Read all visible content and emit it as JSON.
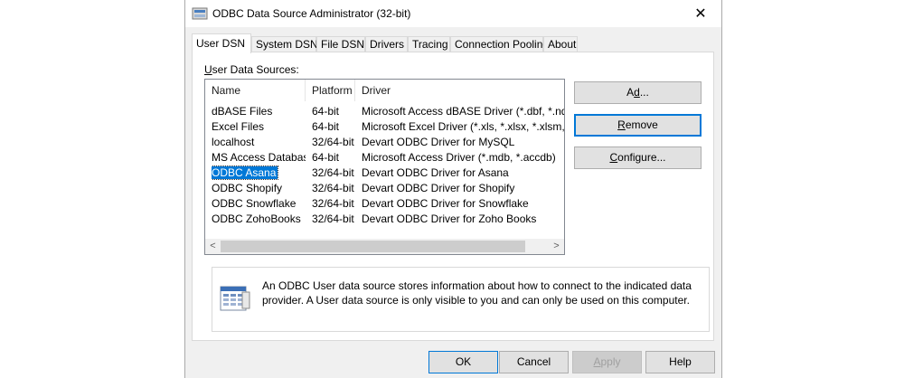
{
  "window": {
    "title": "ODBC Data Source Administrator (32-bit)",
    "close_glyph": "✕"
  },
  "tabs": [
    {
      "label": "User DSN"
    },
    {
      "label": "System DSN"
    },
    {
      "label": "File DSN"
    },
    {
      "label": "Drivers"
    },
    {
      "label": "Tracing"
    },
    {
      "label": "Connection Pooling"
    },
    {
      "label": "About"
    }
  ],
  "panel": {
    "label_accel": "U",
    "label_rest": "ser Data Sources:",
    "columns": [
      "Name",
      "Platform",
      "Driver"
    ],
    "rows": [
      {
        "name": "dBASE Files",
        "platform": "64-bit",
        "driver": "Microsoft Access dBASE Driver (*.dbf, *.ndx, *.m"
      },
      {
        "name": "Excel Files",
        "platform": "64-bit",
        "driver": "Microsoft Excel Driver (*.xls, *.xlsx, *.xlsm, *.xlsb"
      },
      {
        "name": "localhost",
        "platform": "32/64-bit",
        "driver": "Devart ODBC Driver for MySQL"
      },
      {
        "name": "MS Access Database",
        "platform": "64-bit",
        "driver": "Microsoft Access Driver (*.mdb, *.accdb)"
      },
      {
        "name": "ODBC Asana",
        "platform": "32/64-bit",
        "driver": "Devart ODBC Driver for Asana"
      },
      {
        "name": "ODBC Shopify",
        "platform": "32/64-bit",
        "driver": "Devart ODBC Driver for Shopify"
      },
      {
        "name": "ODBC Snowflake",
        "platform": "32/64-bit",
        "driver": "Devart ODBC Driver for Snowflake"
      },
      {
        "name": "ODBC ZohoBooks",
        "platform": "32/64-bit",
        "driver": "Devart ODBC Driver for Zoho Books"
      }
    ],
    "selected_row": "ODBC Asana",
    "scroll_left": "<",
    "scroll_right": ">"
  },
  "side_buttons": {
    "add_accel": "d",
    "add_pre": "A",
    "add_post": "...",
    "remove_accel": "R",
    "remove_rest": "emove",
    "configure_accel": "C",
    "configure_rest": "onfigure..."
  },
  "info": {
    "text": "An ODBC User data source stores information about how to connect to the indicated data provider.   A User data source is only visible to you and can only be used on this computer."
  },
  "footer": {
    "ok": "OK",
    "cancel": "Cancel",
    "apply_accel": "A",
    "apply_rest": "pply",
    "help": "Help"
  },
  "colors": {
    "accent": "#0078d7",
    "selection": "#0078d7",
    "window_bg": "#f0f0f0",
    "button_bg": "#e1e1e1"
  }
}
